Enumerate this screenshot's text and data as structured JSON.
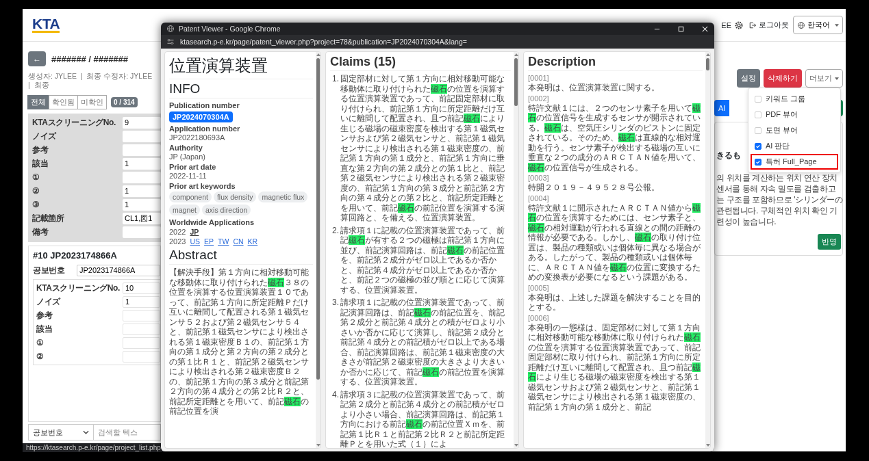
{
  "app": {
    "logo": "KTA",
    "user": "EE",
    "logout": "로그아웃",
    "language": "한국어",
    "back": "←",
    "title": "####### / #######",
    "meta": "생성자: JYLEE  |  최종 수정자: JYLEE  |  최종",
    "filter_tabs": [
      {
        "label": "전체",
        "selected": true
      },
      {
        "label": "확인됨",
        "selected": false
      },
      {
        "label": "미확인",
        "selected": false
      }
    ],
    "progress_badge": "0 / 314",
    "form_rows": [
      {
        "label": "KTAスクリーニングNo.",
        "value": "9"
      },
      {
        "label": "ノイズ"
      },
      {
        "label": "参考"
      },
      {
        "label": "該当",
        "value": "1"
      },
      {
        "label": "①"
      },
      {
        "label": "②",
        "value": "1"
      },
      {
        "label": "③",
        "value": "1"
      },
      {
        "label": "記載箇所",
        "value": "CL1,図1"
      },
      {
        "label": "備考"
      }
    ],
    "next_card": {
      "title": "#10 JP2023174866A",
      "publication_label": "공보번호",
      "publication_value": "JP2023174866A",
      "rows": [
        {
          "label": "KTAスクリーニングNo.",
          "value": "10"
        },
        {
          "label": "ノイズ",
          "value": "1"
        },
        {
          "label": "参考"
        },
        {
          "label": "該当"
        },
        {
          "label": "①"
        },
        {
          "label": "②"
        }
      ]
    },
    "search_bar": {
      "field": "공보번호",
      "placeholder": "검색할 텍스"
    },
    "status_url": "https://ktasearch.p-e.kr/page/project_list.php",
    "actions": [
      {
        "label": "설정",
        "kind": "secondary"
      },
      {
        "label": "삭제하기",
        "kind": "danger"
      },
      {
        "label": "더보기",
        "kind": "dropdown"
      }
    ],
    "more_menu": [
      {
        "label": "키워드 그룹",
        "checked": false,
        "highlighted": false
      },
      {
        "label": "PDF 뷰어",
        "checked": false,
        "highlighted": false
      },
      {
        "label": "도면 뷰어",
        "checked": false,
        "highlighted": false
      },
      {
        "label": "AI 판단",
        "checked": true,
        "highlighted": false
      },
      {
        "label": "특허 Full_Page",
        "checked": true,
        "highlighted": true
      }
    ],
    "ai_button": "AI",
    "ai_card": {
      "heading": "きるも",
      "lines": [
        "의 위치를 계산하는 위치 연산 장치",
        "센서를 통해 자속 밀도를 검출하고",
        "는 구조를 포함하므로 'シリンダーの",
        "관련됩니다. 구체적인 위치 확인 기",
        "련성이 높습니다."
      ],
      "apply_button": "반영"
    }
  },
  "popup": {
    "window_title": "Patent Viewer - Google Chrome",
    "url": "ktasearch.p-e.kr/page/patent_viewer.php?project=78&publication=JP2024070304A&lang=",
    "title": "位置演算装置",
    "info_heading": "INFO",
    "fields": [
      {
        "label": "Publication number",
        "value": "JP2024070304A",
        "kind": "badge"
      },
      {
        "label": "Application number",
        "value": "JP2022180693A",
        "kind": "text"
      },
      {
        "label": "Authority",
        "value": "JP (Japan)",
        "kind": "text"
      },
      {
        "label": "Prior art date",
        "value": "2022-11-11",
        "kind": "text"
      }
    ],
    "keywords_label": "Prior art keywords",
    "keywords": [
      "component",
      "flux density",
      "magnetic flux",
      "magnet",
      "axis direction"
    ],
    "worldwide_label": "Worldwide Applications",
    "worldwide": [
      {
        "year": "2022",
        "codes": [
          {
            "code": "JP",
            "selected": true
          }
        ]
      },
      {
        "year": "2023",
        "codes": [
          {
            "code": "US",
            "selected": false
          },
          {
            "code": "EP",
            "selected": false
          },
          {
            "code": "TW",
            "selected": false
          },
          {
            "code": "CN",
            "selected": false
          },
          {
            "code": "KR",
            "selected": false
          }
        ]
      }
    ],
    "abstract_heading": "Abstract",
    "abstract": [
      {
        "text": "【解決手段】第１方向に相対移動可能な移動体に取り付けられた",
        "highlighted": false
      },
      {
        "text": "磁石",
        "highlighted": true
      },
      {
        "text": "３８の位置を演算する位置演算装置１０であって、前記第１方向に所定距離Ｐだけ互いに離間して配置される第１磁気センサ５２および第２磁気センサ５４と、前記第１磁気センサにより検出される第１磁束密度Ｂ１の、前記第１方向の第１成分と第２方向の第２成分との第１比Ｒ１と、前記第２磁気センサにより検出される第２磁束密度Ｂ２の、前記第１方向の第３成分と前記第２方向の第４成分との第２比Ｒ２と、前記所定距離とを用いて、前記",
        "highlighted": false
      },
      {
        "text": "磁石",
        "highlighted": true
      },
      {
        "text": "の前記位置を演",
        "highlighted": false
      }
    ],
    "claims_heading": "Claims (15)",
    "claims": [
      {
        "number": "1.",
        "segments": [
          {
            "text": "固定部材に対して第１方向に相対移動可能な移動体に取り付けられた",
            "highlighted": false
          },
          {
            "text": "磁石",
            "highlighted": true
          },
          {
            "text": "の位置を演算する位置演算装置であって、前記固定部材に取り付けられ、前記第１方向に所定距離だけ互いに離間して配置され、且つ前記",
            "highlighted": false
          },
          {
            "text": "磁石",
            "highlighted": true
          },
          {
            "text": "により生じる磁場の磁束密度を検出する第１磁気センサおよび第２磁気センサと、前記第１磁気センサにより検出される第１磁束密度の、前記第１方向の第１成分と、前記第１方向に垂直な第２方向の第２成分との第１比と、前記第２磁気センサにより検出される第２磁束密度の、前記第１方向の第３成分と前記第２方向の第４成分との第２比と、前記所定距離とを用いて、前記",
            "highlighted": false
          },
          {
            "text": "磁石",
            "highlighted": true
          },
          {
            "text": "の前記位置を演算する演算回路と、を備える、位置演算装置。",
            "highlighted": false
          }
        ]
      },
      {
        "number": "2.",
        "segments": [
          {
            "text": "請求項１に記載の位置演算装置であって、前記",
            "highlighted": false
          },
          {
            "text": "磁石",
            "highlighted": true
          },
          {
            "text": "が有する２つの磁極は前記第１方向に並び、前記演算回路は、前記",
            "highlighted": false
          },
          {
            "text": "磁石",
            "highlighted": true
          },
          {
            "text": "の前記位置を、前記第２成分がゼロ以上であるか否かと、前記第４成分がゼロ以上であるか否かと、前記２つの磁極の並び順とに応じて演算する、位置演算装置。",
            "highlighted": false
          }
        ]
      },
      {
        "number": "3.",
        "segments": [
          {
            "text": "請求項１に記載の位置演算装置であって、前記演算回路は、前記",
            "highlighted": false
          },
          {
            "text": "磁石",
            "highlighted": true
          },
          {
            "text": "の前記位置を、前記第２成分と前記第４成分との積がゼロより小さいか否かに応じて演算し、前記第２成分と前記第４成分との前記積がゼロ以上である場合、前記演算回路は、前記第１磁束密度の大きさが前記第２磁束密度の大きさより大きいか否かに応じて、前記",
            "highlighted": false
          },
          {
            "text": "磁石",
            "highlighted": true
          },
          {
            "text": "の前記位置を演算する、位置演算装置。",
            "highlighted": false
          }
        ]
      },
      {
        "number": "4.",
        "segments": [
          {
            "text": "請求項３に記載の位置演算装置であって、前記第２成分と前記第４成分との前記積がゼロより小さい場合、前記演算回路は、前記第１方向における前記",
            "highlighted": false
          },
          {
            "text": "磁石",
            "highlighted": true
          },
          {
            "text": "の前記位置Ｘｍを、前記第１比Ｒ１と前記第２比Ｒ２と前記所定距離Ｐとを用いた式（１）によ",
            "highlighted": false
          }
        ]
      }
    ],
    "description_heading": "Description",
    "description": [
      {
        "number": "[0001]",
        "segments": [
          {
            "text": "本発明は、位置演算装置に関する。",
            "highlighted": false
          }
        ]
      },
      {
        "number": "[0002]",
        "segments": [
          {
            "text": "特許文献１には、２つのセンサ素子を用いて",
            "highlighted": false
          },
          {
            "text": "磁石",
            "highlighted": true
          },
          {
            "text": "の位置信号を生成するセンサが開示されている。",
            "highlighted": false
          },
          {
            "text": "磁石",
            "highlighted": true
          },
          {
            "text": "は、空気圧シリンダのピストンに固定されている。そのため、",
            "highlighted": false
          },
          {
            "text": "磁石",
            "highlighted": true
          },
          {
            "text": "は直線的な相対運動を行う。センサ素子が検出する磁場の互いに垂直な２つの成分のＡＲＣＴＡＮ値を用いて、",
            "highlighted": false
          },
          {
            "text": "磁石",
            "highlighted": true
          },
          {
            "text": "の位置信号が生成される。",
            "highlighted": false
          }
        ]
      },
      {
        "number": "[0003]",
        "segments": [
          {
            "text": "特開２０１９－４９５２８号公報。",
            "highlighted": false
          }
        ]
      },
      {
        "number": "[0004]",
        "segments": [
          {
            "text": "特許文献１に開示されたＡＲＣＴＡＮ値から",
            "highlighted": false
          },
          {
            "text": "磁石",
            "highlighted": true
          },
          {
            "text": "の位置を演算するためには、センサ素子と、",
            "highlighted": false
          },
          {
            "text": "磁石",
            "highlighted": true
          },
          {
            "text": "の相対運動が行われる直線との間の距離の情報が必要である。しかし、",
            "highlighted": false
          },
          {
            "text": "磁石",
            "highlighted": true
          },
          {
            "text": "の取り付け位置は、製品の種類或いは個体毎に異なる場合がある。したがって、製品の種類或いは個体毎に、ＡＲＣＴＡＮ値を",
            "highlighted": false
          },
          {
            "text": "磁石",
            "highlighted": true
          },
          {
            "text": "の位置に変換するための変換表が必要になるという課題がある。",
            "highlighted": false
          }
        ]
      },
      {
        "number": "[0005]",
        "segments": [
          {
            "text": "本発明は、上述した課題を解決することを目的とする。",
            "highlighted": false
          }
        ]
      },
      {
        "number": "[0006]",
        "segments": [
          {
            "text": "本発明の一態様は、固定部材に対して第１方向に相対移動可能な移動体に取り付けられた",
            "highlighted": false
          },
          {
            "text": "磁石",
            "highlighted": true
          },
          {
            "text": "の位置を演算する位置演算装置であって、前記固定部材に取り付けられ、前記第１方向に所定距離だけ互いに離間して配置され、且つ前記",
            "highlighted": false
          },
          {
            "text": "磁石",
            "highlighted": true
          },
          {
            "text": "により生じる磁場の磁束密度を検出する第１磁気センサおよび第２磁気センサと、前記第１磁気センサにより検出される第１磁束密度の、前記第１方向の第１成分と、前記",
            "highlighted": false
          }
        ]
      }
    ]
  }
}
